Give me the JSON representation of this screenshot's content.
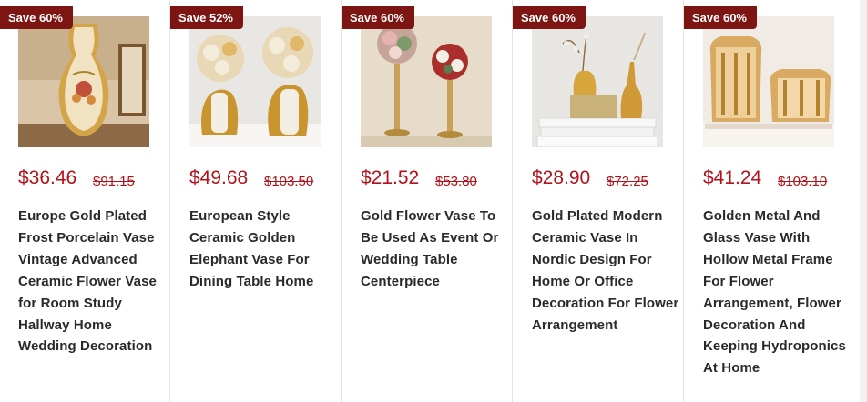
{
  "products": [
    {
      "badge": "Save 60%",
      "price": "$36.46",
      "old_price": "$91.15",
      "title": "Europe Gold Plated Frost Porcelain Vase Vintage Advanced Ceramic Flower Vase for Room Study Hallway Home Wedding Decoration",
      "image": "gold-porcelain-vase"
    },
    {
      "badge": "Save 52%",
      "price": "$49.68",
      "old_price": "$103.50",
      "title": "European Style Ceramic Golden Elephant Vase For Dining Table Home",
      "image": "golden-elephant-vases"
    },
    {
      "badge": "Save 60%",
      "price": "$21.52",
      "old_price": "$53.80",
      "title": "Gold Flower Vase To Be Used As Event Or Wedding Table Centerpiece",
      "image": "gold-centerpiece-vases"
    },
    {
      "badge": "Save 60%",
      "price": "$28.90",
      "old_price": "$72.25",
      "title": "Gold Plated Modern Ceramic Vase In Nordic Design For Home Or Office Decoration For Flower Arrangement",
      "image": "nordic-gold-vases"
    },
    {
      "badge": "Save 60%",
      "price": "$41.24",
      "old_price": "$103.10",
      "title": "Golden Metal And Glass Vase With Hollow Metal Frame For Flower Arrangement, Flower Decoration And Keeping Hydroponics At Home",
      "image": "metal-glass-vases"
    }
  ],
  "colors": {
    "badge": "#7d1612",
    "price": "#b2121a",
    "title": "#2a2a2a"
  }
}
